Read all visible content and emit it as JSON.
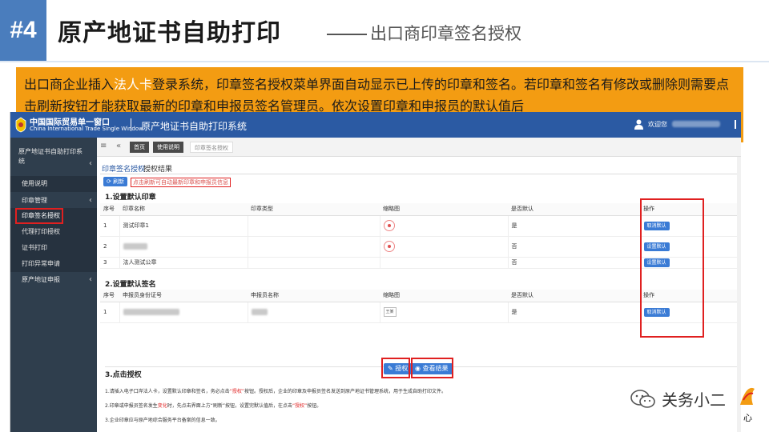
{
  "slide": {
    "badge": "#4",
    "title": "原产地证书自助打印",
    "subtitle": "出口商印章签名授权"
  },
  "description": {
    "part1": "出口商企业插入",
    "highlight": "法人卡",
    "part2": "登录系统，印章签名授权菜单界面自动显示已上传的印章和签名。若印章和签名有修改或删除则需要点击刷新按钮才能获取最新的印章和申报员签名管理员。依次设置印章和申报员的默认值后"
  },
  "app": {
    "logo_cn": "中国国际贸易单一窗口",
    "logo_en": "China International Trade Single Window",
    "system_title": "原产地证书自助打印系统",
    "welcome": "欢迎您",
    "sidebar": {
      "title": "原产地证书自助打印系统",
      "items": [
        {
          "label": "使用说明"
        },
        {
          "label": "印章管理"
        },
        {
          "label": "印章签名授权"
        },
        {
          "label": "代理打印授权"
        },
        {
          "label": "证书打印"
        },
        {
          "label": "打印异常申请"
        },
        {
          "label": "原产地证申报"
        }
      ]
    },
    "tabs": {
      "home": "首页",
      "usage": "使用说明",
      "current": "印章签名授权"
    },
    "subtabs": [
      "印章签名授权",
      "授权结果"
    ],
    "refresh_label": "刷新",
    "refresh_hint": "点击刷新可自动最新印章和申报员信息",
    "section1": {
      "title": "1.设置默认印章",
      "headers": [
        "序号",
        "印章名称",
        "印章类型",
        "缩略图",
        "是否默认",
        "操作"
      ],
      "rows": [
        {
          "no": "1",
          "name": "测试印章1",
          "default": "是",
          "action": "取消默认"
        },
        {
          "no": "2",
          "name": "",
          "default": "否",
          "action": "设置默认"
        },
        {
          "no": "3",
          "name": "法人测试公章",
          "default": "否",
          "action": "设置默认"
        }
      ]
    },
    "section2": {
      "title": "2.设置默认签名",
      "headers": [
        "序号",
        "申报员身份证号",
        "申报员名称",
        "缩略图",
        "是否默认",
        "操作"
      ],
      "rows": [
        {
          "no": "1",
          "sig_text": "王某",
          "default": "是",
          "action": "取消默认"
        }
      ]
    },
    "section3": {
      "title": "3.点击授权",
      "grant_label": "授权",
      "view_label": "查看结果",
      "hint1_a": "1.请插入电子口岸法人卡，设置默认印章和签名，务必点击",
      "hint1_red": "“授权”",
      "hint1_b": "按钮。授权后，企业的印章及申报员签名发送到原产地证书管理系统，用于生成自助打印文件。",
      "hint2_a": "2.印章或申报员签名发生",
      "hint2_red1": "变化",
      "hint2_b": "时，先点击界面上方“刷新”按钮，设置完默认值后，在点击",
      "hint2_red2": "“授权”",
      "hint2_c": "按钮。",
      "hint3": "3.企业印章应与原产地综合服务平台备案的信息一致。"
    }
  },
  "watermark": {
    "text": "关务小二",
    "char": "心"
  },
  "colors": {
    "badge": "#4a7dbd",
    "orange": "#f39c12",
    "app_blue": "#2b5aa3",
    "sidebar": "#2f3e4d",
    "highlight_red": "#e02020"
  }
}
